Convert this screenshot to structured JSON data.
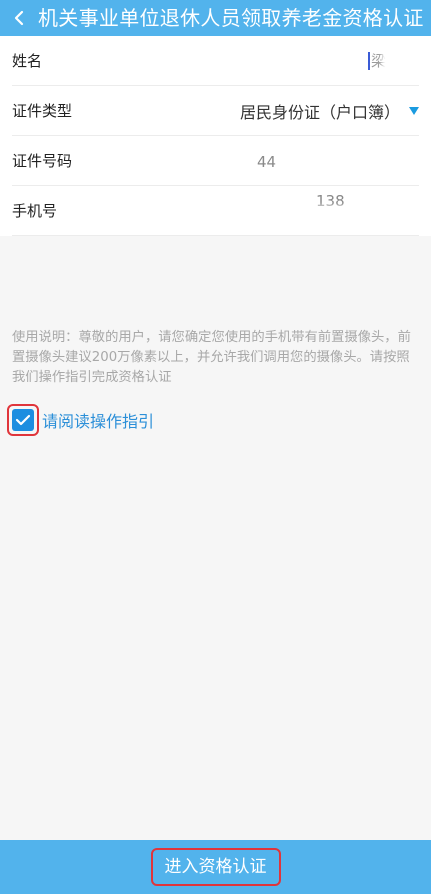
{
  "header": {
    "title": "机关事业单位退休人员领取养老金资格认证"
  },
  "form": {
    "name": {
      "label": "姓名",
      "value": "梁"
    },
    "id_type": {
      "label": "证件类型",
      "value": "居民身份证（户口簿）"
    },
    "id_number": {
      "label": "证件号码",
      "value": "44"
    },
    "phone": {
      "label": "手机号",
      "value": "138"
    }
  },
  "instructions": "使用说明：尊敬的用户，请您确定您使用的手机带有前置摄像头，前置摄像头建议200万像素以上，并允许我们调用您的摄像头。请按照我们操作指引完成资格认证",
  "consent": {
    "checked": true,
    "label": "请阅读操作指引"
  },
  "submit": {
    "label": "进入资格认证"
  },
  "colors": {
    "header_bg": "#52b3ec",
    "accent": "#1d8ee0",
    "highlight_outline": "#e0353b"
  },
  "icons": {
    "back": "chevron-left-icon",
    "dropdown": "triangle-down-icon",
    "check": "check-icon"
  }
}
